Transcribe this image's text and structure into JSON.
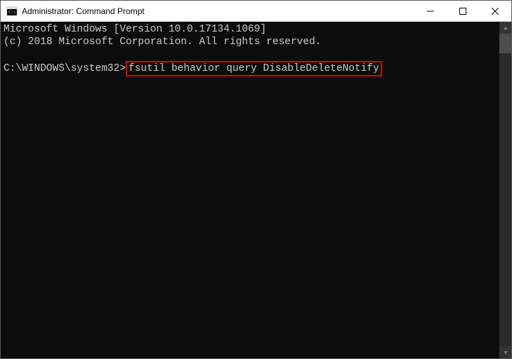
{
  "window": {
    "title": "Administrator: Command Prompt"
  },
  "terminal": {
    "line1": "Microsoft Windows [Version 10.0.17134.1069]",
    "line2": "(c) 2018 Microsoft Corporation. All rights reserved.",
    "prompt": "C:\\WINDOWS\\system32>",
    "command": "fsutil behavior query DisableDeleteNotify"
  }
}
